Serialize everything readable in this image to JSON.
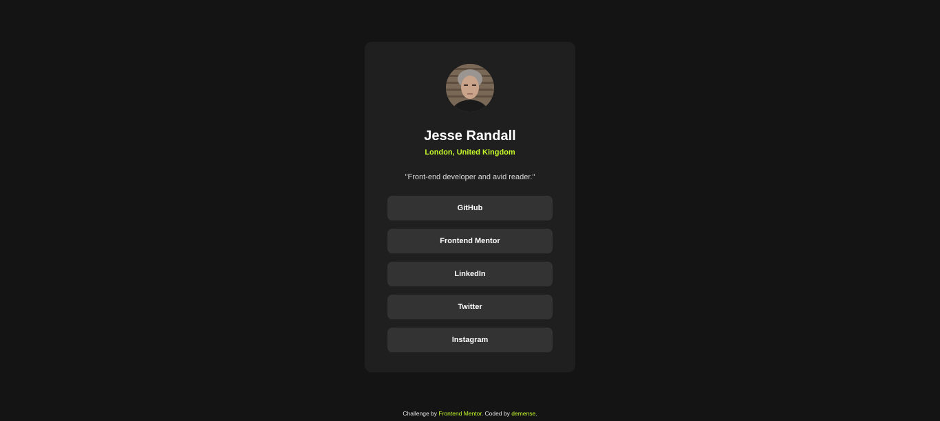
{
  "profile": {
    "avatar_alt": "Jesse Randall",
    "name": "Jesse Randall",
    "location": "London, United Kingdom",
    "bio": "\"Front-end developer and avid reader.\""
  },
  "links": [
    {
      "label": "GitHub"
    },
    {
      "label": "Frontend Mentor"
    },
    {
      "label": "LinkedIn"
    },
    {
      "label": "Twitter"
    },
    {
      "label": "Instagram"
    }
  ],
  "footer": {
    "prefix": "Challenge by ",
    "challenge_link": "Frontend Mentor",
    "middle": ". Coded by ",
    "author_link": "demense",
    "suffix": "."
  },
  "colors": {
    "page_background": "#141414",
    "card_background": "#1f1f1f",
    "button_background": "#333333",
    "accent": "#c4f82a"
  }
}
